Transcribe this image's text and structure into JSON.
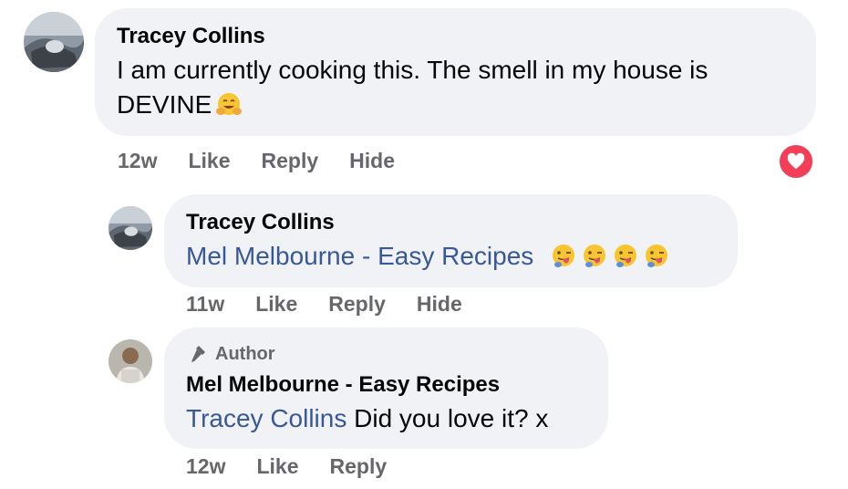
{
  "comments": [
    {
      "author": "Tracey Collins",
      "text": "I am currently cooking this. The smell in my house is",
      "text_line2": "DEVINE",
      "time": "12w",
      "like": "Like",
      "reply": "Reply",
      "hide": "Hide",
      "reaction": "love",
      "emoji": "hugging-face"
    },
    {
      "author": "Tracey Collins",
      "mention": "Mel Melbourne - Easy Recipes",
      "emoji": "face-with-tongue",
      "emoji_count": 4,
      "time": "11w",
      "like": "Like",
      "reply": "Reply",
      "hide": "Hide"
    },
    {
      "badge": "Author",
      "author": "Mel Melbourne - Easy Recipes",
      "mention": "Tracey Collins",
      "text": "Did you love it? x",
      "time": "12w",
      "like": "Like",
      "reply": "Reply"
    }
  ],
  "colors": {
    "bubble": "#f0f2f5",
    "link": "#385898",
    "meta": "#65676b",
    "love": "#f33e58"
  }
}
